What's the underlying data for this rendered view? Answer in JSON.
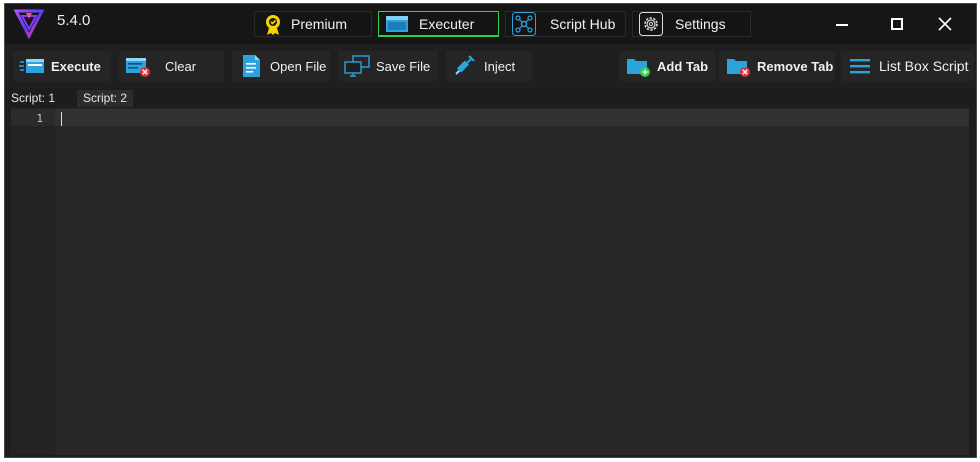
{
  "app": {
    "version": "5.4.0"
  },
  "nav_tabs": [
    {
      "label": "Premium",
      "icon": "premium-badge-icon",
      "active": false
    },
    {
      "label": "Executer",
      "icon": "window-icon",
      "active": true
    },
    {
      "label": "Script Hub",
      "icon": "network-hub-icon",
      "active": false
    },
    {
      "label": "Settings",
      "icon": "gear-icon",
      "active": false
    }
  ],
  "window_controls": [
    "minimize",
    "maximize",
    "close"
  ],
  "toolbar": {
    "execute": "Execute",
    "clear": "Clear",
    "open_file": "Open File",
    "save_file": "Save File",
    "inject": "Inject",
    "add_tab": "Add Tab",
    "remove_tab": "Remove Tab",
    "list_box_script": "List Box Script"
  },
  "script_tabs": [
    {
      "label": "Script: 1",
      "selected": true
    },
    {
      "label": "Script: 2",
      "selected": false
    }
  ],
  "editor": {
    "line_numbers": [
      "1"
    ],
    "content": ""
  },
  "colors": {
    "accent_green": "#2fcf4d",
    "icon_blue": "#1fa6e0",
    "danger_red": "#e0323a",
    "logo_purple": "#7a3cff"
  }
}
